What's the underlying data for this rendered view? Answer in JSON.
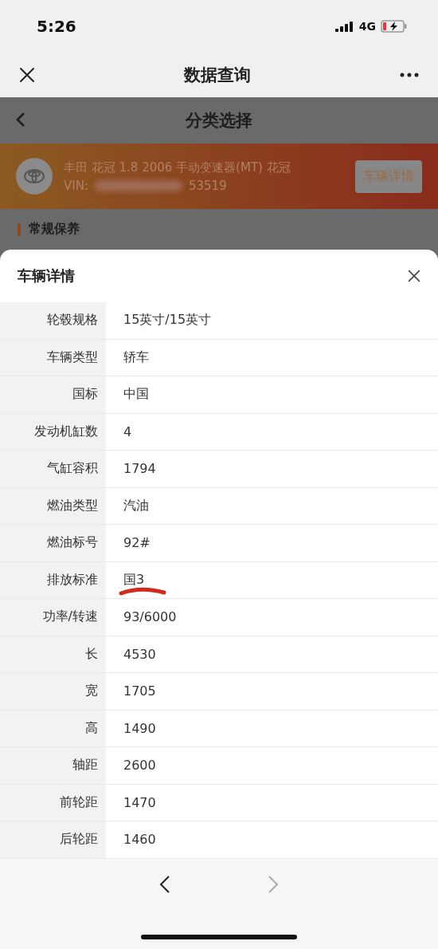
{
  "status_bar": {
    "time": "5:26",
    "network": "4G"
  },
  "nav_bar": {
    "title": "数据查询"
  },
  "page": {
    "title": "分类选择",
    "vehicle": {
      "name": "丰田 花冠 1.8 2006 手动变速器(MT) 花冠",
      "vin_label": "VIN:",
      "vin_tail": "53519",
      "details_button": "车辆详情"
    },
    "section": "常规保养"
  },
  "sheet": {
    "title": "车辆详情",
    "rows": [
      {
        "label": "轮毂规格",
        "value": "15英寸/15英寸",
        "highlighted": false
      },
      {
        "label": "车辆类型",
        "value": "轿车",
        "highlighted": false
      },
      {
        "label": "国标",
        "value": "中国",
        "highlighted": false
      },
      {
        "label": "发动机缸数",
        "value": "4",
        "highlighted": false
      },
      {
        "label": "气缸容积",
        "value": "1794",
        "highlighted": false
      },
      {
        "label": "燃油类型",
        "value": "汽油",
        "highlighted": false
      },
      {
        "label": "燃油标号",
        "value": "92#",
        "highlighted": false
      },
      {
        "label": "排放标准",
        "value": "国3",
        "highlighted": true
      },
      {
        "label": "功率/转速",
        "value": "93/6000",
        "highlighted": false
      },
      {
        "label": "长",
        "value": "4530",
        "highlighted": false
      },
      {
        "label": "宽",
        "value": "1705",
        "highlighted": false
      },
      {
        "label": "高",
        "value": "1490",
        "highlighted": false
      },
      {
        "label": "轴距",
        "value": "2600",
        "highlighted": false
      },
      {
        "label": "前轮距",
        "value": "1470",
        "highlighted": false
      },
      {
        "label": "后轮距",
        "value": "1460",
        "highlighted": false
      }
    ]
  },
  "toolbar": {
    "back_disabled": false,
    "forward_disabled": true
  }
}
